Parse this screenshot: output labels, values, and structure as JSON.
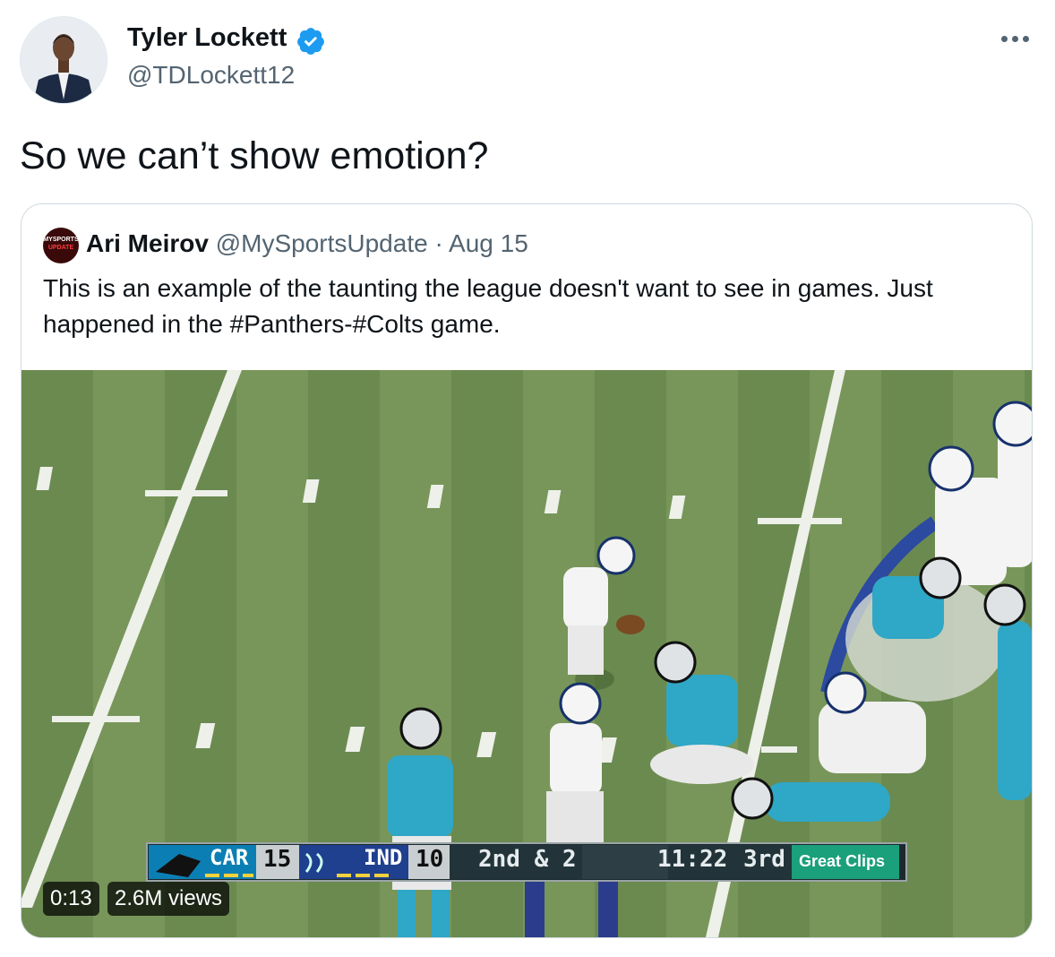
{
  "tweet": {
    "author_name": "Tyler Lockett",
    "author_handle": "@TDLockett12",
    "text": "So we can’t show emotion?"
  },
  "quoted_tweet": {
    "author_name": "Ari Meirov",
    "author_handle": "@MySportsUpdate",
    "separator": " · ",
    "date": "Aug 15",
    "text": "This is an example of the taunting the league doesn't want to see in games. Just happened in the #Panthers-#Colts game.",
    "avatar_text_top": "MYSPORTS",
    "avatar_text_bottom": "UPDATE"
  },
  "video": {
    "timestamp": "0:13",
    "views": "2.6M views",
    "scorebug": {
      "away_team": "CAR",
      "away_score": "15",
      "home_team": "IND",
      "home_score": "10",
      "down_distance": "2nd & 2",
      "clock": "11:22",
      "quarter": "3rd",
      "sponsor": "Great Clips"
    }
  },
  "colors": {
    "verified": "#1d9bf0",
    "text_secondary": "#536471",
    "border": "#cfd9de",
    "field_green": "#6f8c55",
    "panthers_teal": "#0085ca",
    "colts_blue": "#002c5f"
  }
}
